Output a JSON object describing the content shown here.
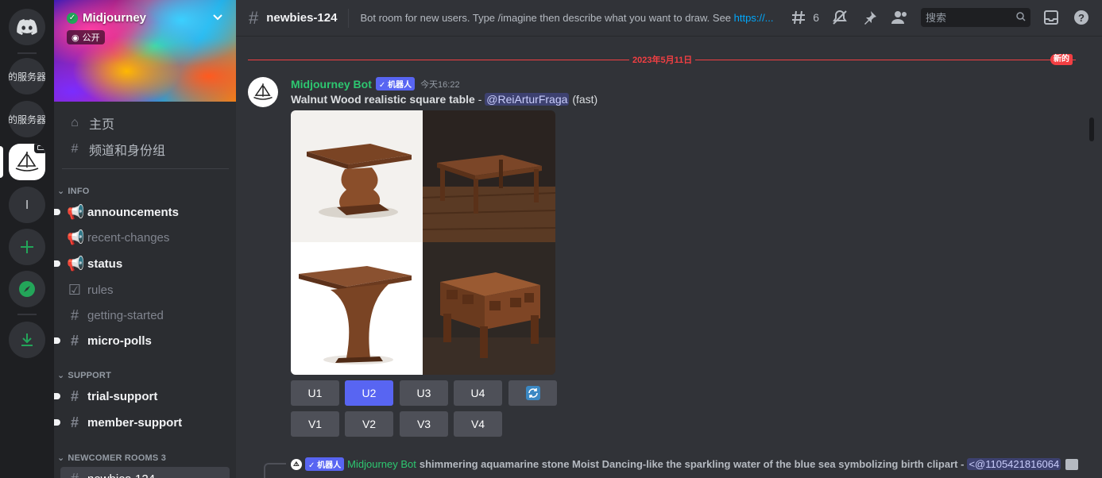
{
  "rail": {
    "server_texts": [
      "的服务器",
      "的服务器"
    ],
    "l_label": "l"
  },
  "server": {
    "name": "Midjourney",
    "public_label": "公开"
  },
  "nav": {
    "home": "主页",
    "channels_roles": "频道和身份组"
  },
  "categories": [
    {
      "name": "INFO",
      "channels": [
        {
          "name": "announcements",
          "icon": "megaphone-icon",
          "unread": true
        },
        {
          "name": "recent-changes",
          "icon": "megaphone-icon",
          "unread": false
        },
        {
          "name": "status",
          "icon": "megaphone-icon",
          "unread": true
        },
        {
          "name": "rules",
          "icon": "checkbox-icon",
          "unread": false
        },
        {
          "name": "getting-started",
          "icon": "hash-icon",
          "unread": false
        },
        {
          "name": "micro-polls",
          "icon": "hash-icon",
          "unread": true
        }
      ]
    },
    {
      "name": "SUPPORT",
      "channels": [
        {
          "name": "trial-support",
          "icon": "hash-icon",
          "unread": true
        },
        {
          "name": "member-support",
          "icon": "hash-icon",
          "unread": true
        }
      ]
    },
    {
      "name": "NEWCOMER ROOMS 3",
      "channels": [
        {
          "name": "newbies-124",
          "icon": "hash-icon",
          "unread": false,
          "active": true
        }
      ]
    }
  ],
  "header": {
    "channel": "newbies-124",
    "topic": "Bot room for new users. Type /imagine then describe what you want to draw. See ",
    "topic_link": "https://...",
    "threads_count": "6",
    "search_placeholder": "搜索"
  },
  "divider": {
    "date": "2023年5月11日",
    "new_label": "新的"
  },
  "message": {
    "author": "Midjourney Bot",
    "bot_tag": "✓ 机器人",
    "time": "今天16:22",
    "prompt": "Walnut Wood realistic square table",
    "separator": " - ",
    "mention": "@ReiArturFraga",
    "speed": "(fast)",
    "buttons_u": [
      "U1",
      "U2",
      "U3",
      "U4"
    ],
    "buttons_v": [
      "V1",
      "V2",
      "V3",
      "V4"
    ],
    "reroll": "reroll-icon"
  },
  "reply": {
    "bot_tag": "✓ 机器人",
    "author": "Midjourney Bot",
    "text": "shimmering aquamarine stone Moist Dancing-like the sparkling water of the blue sea symbolizing birth clipart",
    "separator": " - ",
    "mention": "<@1105421816064"
  },
  "colors": {
    "accent": "#5865f2",
    "bot_name": "#2dc770",
    "new_red": "#f23f43"
  }
}
